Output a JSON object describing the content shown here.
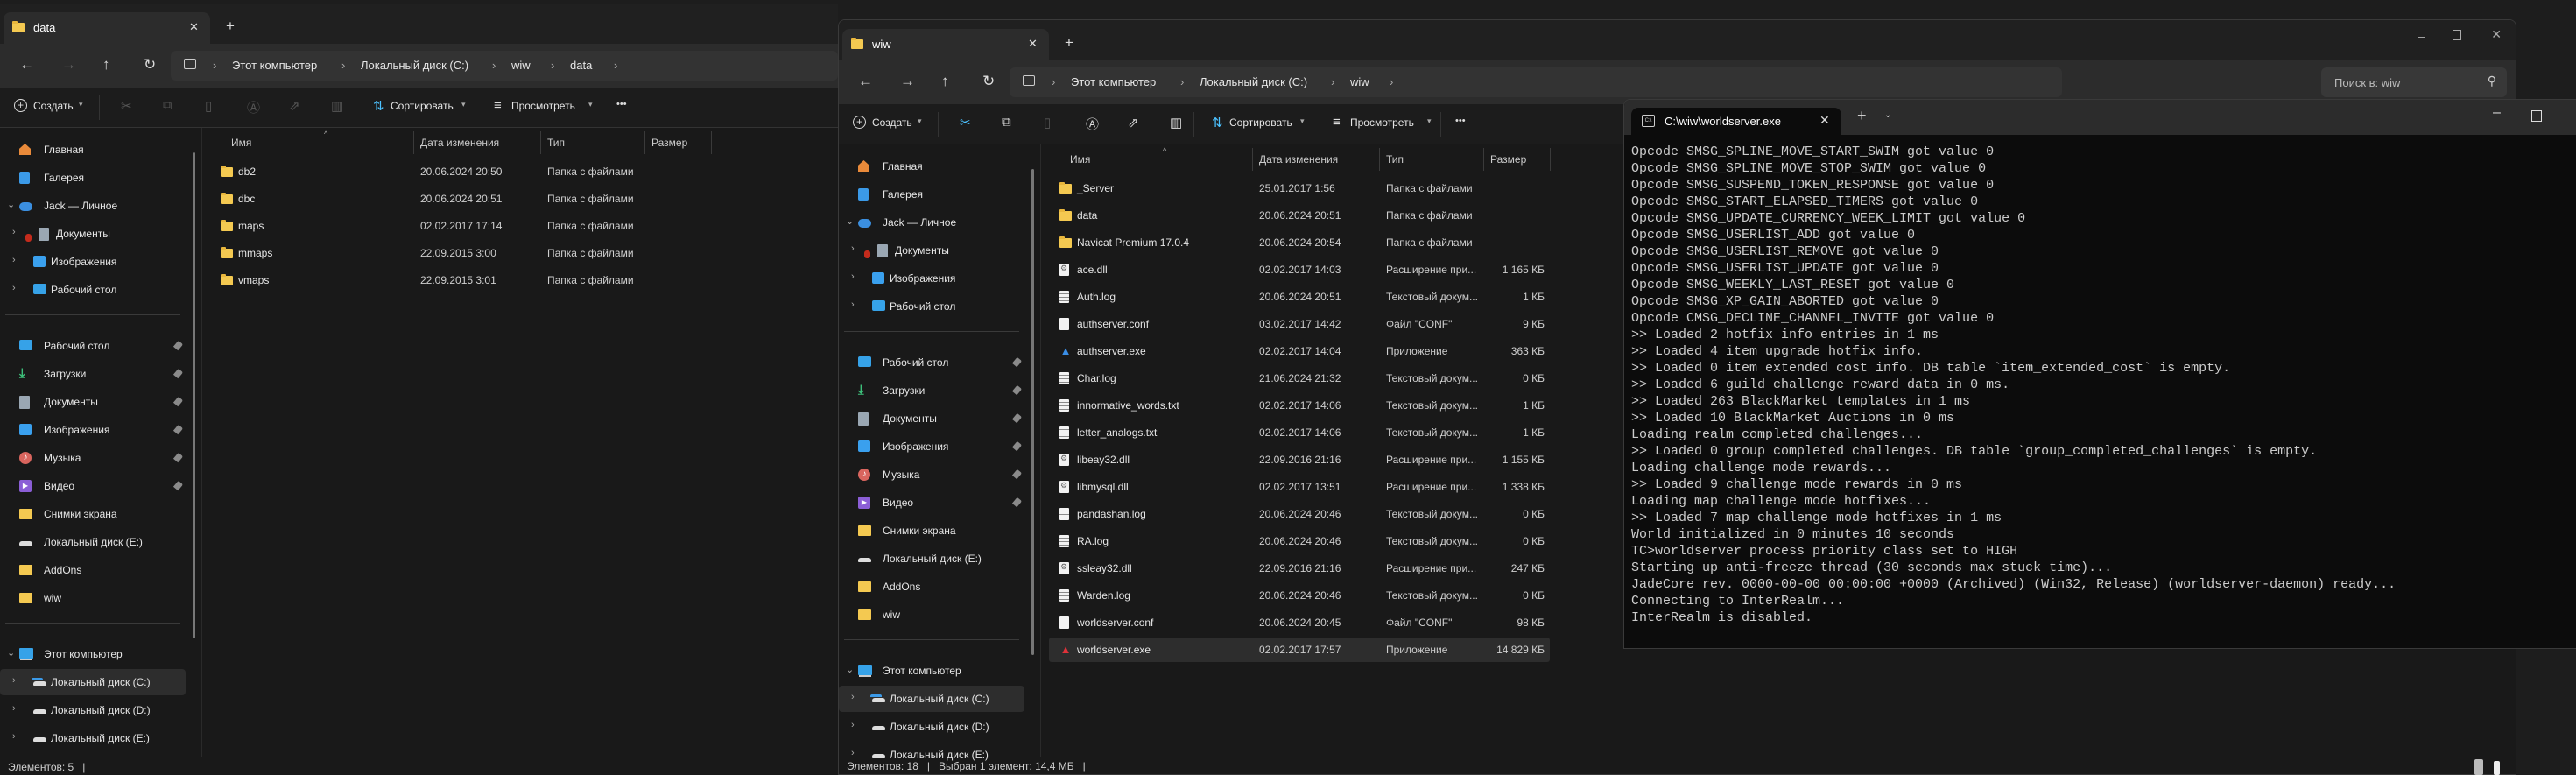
{
  "sidebar": [
    {
      "label": "Главная",
      "icon": "home-icon",
      "level": 0
    },
    {
      "label": "Галерея",
      "icon": "gallery-icon",
      "level": 0
    },
    {
      "label": "Jack — Личное",
      "icon": "cloud-icon",
      "level": 0,
      "expand": "down"
    },
    {
      "label": "Документы",
      "icon": "documents-icon",
      "level": 1,
      "expand": "right",
      "error": true
    },
    {
      "label": "Изображения",
      "icon": "pictures-icon",
      "level": 1,
      "expand": "right"
    },
    {
      "label": "Рабочий стол",
      "icon": "desktop-icon",
      "level": 1,
      "expand": "right"
    },
    {
      "divider": true
    },
    {
      "label": "Рабочий стол",
      "icon": "desktop-icon",
      "level": 0,
      "pinned": true
    },
    {
      "label": "Загрузки",
      "icon": "downloads-icon",
      "level": 0,
      "pinned": true
    },
    {
      "label": "Документы",
      "icon": "documents-icon",
      "level": 0,
      "pinned": true
    },
    {
      "label": "Изображения",
      "icon": "pictures-icon",
      "level": 0,
      "pinned": true
    },
    {
      "label": "Музыка",
      "icon": "music-icon",
      "level": 0,
      "pinned": true
    },
    {
      "label": "Видео",
      "icon": "video-icon",
      "level": 0,
      "pinned": true
    },
    {
      "label": "Снимки экрана",
      "icon": "folder-icon",
      "level": 0
    },
    {
      "label": "Локальный диск (E:)",
      "icon": "drive-icon",
      "level": 0
    },
    {
      "label": "AddOns",
      "icon": "folder-icon",
      "level": 0
    },
    {
      "label": "wiw",
      "icon": "folder-icon",
      "level": 0
    },
    {
      "divider": true
    },
    {
      "label": "Этот компьютер",
      "icon": "computer-icon",
      "level": 0,
      "expand": "down"
    },
    {
      "label": "Локальный диск (C:)",
      "icon": "system-drive-icon",
      "level": 1,
      "expand": "right",
      "selected": true
    },
    {
      "label": "Локальный диск (D:)",
      "icon": "drive-icon",
      "level": 1,
      "expand": "right"
    },
    {
      "label": "Локальный диск (E:)",
      "icon": "drive-icon",
      "level": 1,
      "expand": "right"
    }
  ],
  "toolbar": {
    "create": "Создать",
    "sort": "Сортировать",
    "view": "Просмотреть",
    "more": "•••"
  },
  "columns": {
    "name": "Имя",
    "date": "Дата изменения",
    "type": "Тип",
    "size": "Размер"
  },
  "explorer_data": {
    "tab_title": "data",
    "breadcrumb": [
      "Этот компьютер",
      "Локальный диск (C:)",
      "wiw",
      "data"
    ],
    "files": [
      {
        "name": "db2",
        "date": "20.06.2024 20:50",
        "type": "Папка с файлами",
        "size": "",
        "icon": "folder"
      },
      {
        "name": "dbc",
        "date": "20.06.2024 20:51",
        "type": "Папка с файлами",
        "size": "",
        "icon": "folder"
      },
      {
        "name": "maps",
        "date": "02.02.2017 17:14",
        "type": "Папка с файлами",
        "size": "",
        "icon": "folder"
      },
      {
        "name": "mmaps",
        "date": "22.09.2015 3:00",
        "type": "Папка с файлами",
        "size": "",
        "icon": "folder"
      },
      {
        "name": "vmaps",
        "date": "22.09.2015 3:01",
        "type": "Папка с файлами",
        "size": "",
        "icon": "folder"
      }
    ],
    "status": {
      "count": "Элементов: 5",
      "selected": ""
    }
  },
  "explorer_wiw": {
    "tab_title": "wiw",
    "breadcrumb": [
      "Этот компьютер",
      "Локальный диск (C:)",
      "wiw"
    ],
    "search_placeholder": "Поиск в: wiw",
    "files": [
      {
        "name": "_Server",
        "date": "25.01.2017 1:56",
        "type": "Папка с файлами",
        "size": "",
        "icon": "folder"
      },
      {
        "name": "data",
        "date": "20.06.2024 20:51",
        "type": "Папка с файлами",
        "size": "",
        "icon": "folder"
      },
      {
        "name": "Navicat Premium 17.0.4",
        "date": "20.06.2024 20:54",
        "type": "Папка с файлами",
        "size": "",
        "icon": "folder"
      },
      {
        "name": "ace.dll",
        "date": "02.02.2017 14:03",
        "type": "Расширение при...",
        "size": "1 165 КБ",
        "icon": "dll"
      },
      {
        "name": "Auth.log",
        "date": "20.06.2024 20:51",
        "type": "Текстовый докум...",
        "size": "1 КБ",
        "icon": "text"
      },
      {
        "name": "authserver.conf",
        "date": "03.02.2017 14:42",
        "type": "Файл \"CONF\"",
        "size": "9 КБ",
        "icon": "conf"
      },
      {
        "name": "authserver.exe",
        "date": "02.02.2017 14:04",
        "type": "Приложение",
        "size": "363 КБ",
        "icon": "exe-blue"
      },
      {
        "name": "Char.log",
        "date": "21.06.2024 21:32",
        "type": "Текстовый докум...",
        "size": "0 КБ",
        "icon": "text"
      },
      {
        "name": "innormative_words.txt",
        "date": "02.02.2017 14:06",
        "type": "Текстовый докум...",
        "size": "1 КБ",
        "icon": "text"
      },
      {
        "name": "letter_analogs.txt",
        "date": "02.02.2017 14:06",
        "type": "Текстовый докум...",
        "size": "1 КБ",
        "icon": "text"
      },
      {
        "name": "libeay32.dll",
        "date": "22.09.2016 21:16",
        "type": "Расширение при...",
        "size": "1 155 КБ",
        "icon": "dll"
      },
      {
        "name": "libmysql.dll",
        "date": "02.02.2017 13:51",
        "type": "Расширение при...",
        "size": "1 338 КБ",
        "icon": "dll"
      },
      {
        "name": "pandashan.log",
        "date": "20.06.2024 20:46",
        "type": "Текстовый докум...",
        "size": "0 КБ",
        "icon": "text"
      },
      {
        "name": "RA.log",
        "date": "20.06.2024 20:46",
        "type": "Текстовый докум...",
        "size": "0 КБ",
        "icon": "text"
      },
      {
        "name": "ssleay32.dll",
        "date": "22.09.2016 21:16",
        "type": "Расширение при...",
        "size": "247 КБ",
        "icon": "dll"
      },
      {
        "name": "Warden.log",
        "date": "20.06.2024 20:46",
        "type": "Текстовый докум...",
        "size": "0 КБ",
        "icon": "text"
      },
      {
        "name": "worldserver.conf",
        "date": "20.06.2024 20:45",
        "type": "Файл \"CONF\"",
        "size": "98 КБ",
        "icon": "conf"
      },
      {
        "name": "worldserver.exe",
        "date": "02.02.2017 17:57",
        "type": "Приложение",
        "size": "14 829 КБ",
        "icon": "exe-red",
        "selected": true
      }
    ],
    "status": {
      "count": "Элементов: 18",
      "selected": "Выбран 1 элемент: 14,4 МБ"
    }
  },
  "console": {
    "tab_title": "C:\\wiw\\worldserver.exe",
    "lines": [
      "Opcode SMSG_SPLINE_MOVE_START_SWIM got value 0",
      "Opcode SMSG_SPLINE_MOVE_STOP_SWIM got value 0",
      "Opcode SMSG_SUSPEND_TOKEN_RESPONSE got value 0",
      "Opcode SMSG_START_ELAPSED_TIMERS got value 0",
      "Opcode SMSG_UPDATE_CURRENCY_WEEK_LIMIT got value 0",
      "Opcode SMSG_USERLIST_ADD got value 0",
      "Opcode SMSG_USERLIST_REMOVE got value 0",
      "Opcode SMSG_USERLIST_UPDATE got value 0",
      "Opcode SMSG_WEEKLY_LAST_RESET got value 0",
      "Opcode SMSG_XP_GAIN_ABORTED got value 0",
      "Opcode CMSG_DECLINE_CHANNEL_INVITE got value 0",
      ">> Loaded 2 hotfix info entries in 1 ms",
      ">> Loaded 4 item upgrade hotfix info.",
      ">> Loaded 0 item extended cost info. DB table `item_extended_cost` is empty.",
      ">> Loaded 6 guild challenge reward data in 0 ms.",
      ">> Loaded 263 BlackMarket templates in 1 ms",
      ">> Loaded 10 BlackMarket Auctions in 0 ms",
      "Loading realm completed challenges...",
      ">> Loaded 0 group completed challenges. DB table `group_completed_challenges` is empty.",
      "Loading challenge mode rewards...",
      ">> Loaded 9 challenge mode rewards in 0 ms",
      "Loading map challenge mode hotfixes...",
      ">> Loaded 7 map challenge mode hotfixes in 1 ms",
      "World initialized in 0 minutes 10 seconds",
      "TC>worldserver process priority class set to HIGH",
      "Starting up anti-freeze thread (30 seconds max stuck time)...",
      "JadeCore rev. 0000-00-00 00:00:00 +0000 (Archived) (Win32, Release) (worldserver-daemon) ready...",
      "Connecting to InterRealm...",
      "InterRealm is disabled."
    ]
  },
  "colors": {
    "accent": "#4cc2ff",
    "folder": "#f4c951",
    "console_bg": "#0c0c0c",
    "explorer_bg": "#191919"
  }
}
